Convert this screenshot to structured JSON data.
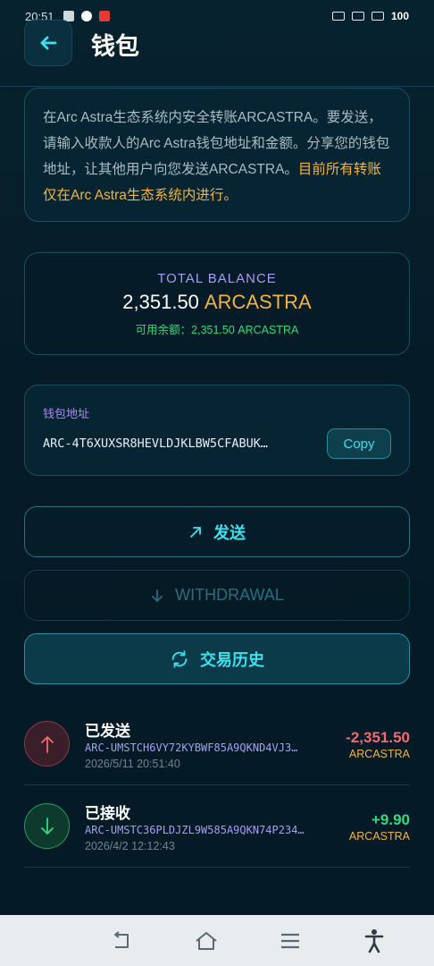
{
  "status_bar": {
    "time": "20:51",
    "battery": "100"
  },
  "header": {
    "title": "钱包"
  },
  "info": {
    "text_normal": "在Arc Astra生态系统内安全转账ARCASTRA。要发送，请输入收款人的Arc Astra钱包地址和金额。分享您的钱包地址，让其他用户向您发送ARCASTRA。",
    "text_highlight": "目前所有转账仅在Arc Astra生态系统内进行。"
  },
  "balance": {
    "label": "TOTAL BALANCE",
    "amount": "2,351.50",
    "unit": "ARCASTRA",
    "available": "可用余额：2,351.50 ARCASTRA"
  },
  "address": {
    "label": "钱包地址",
    "value": "ARC-4T6XUXSR8HEVLDJKLBW5CFABUK…",
    "copy_label": "Copy"
  },
  "actions": {
    "send_label": "发送",
    "withdraw_label": "WITHDRAWAL",
    "history_label": "交易历史"
  },
  "transactions": [
    {
      "type": "已发送",
      "address": "ARC-UMSTCH6VY72KYBWF85A9QKND4VJ3…",
      "date": "2026/5/11 20:51:40",
      "amount": "-2,351.50",
      "unit": "ARCASTRA",
      "direction": "out"
    },
    {
      "type": "已接收",
      "address": "ARC-UMSTC36PLDJZL9W585A9QKN74P234…",
      "date": "2026/4/2 12:12:43",
      "amount": "+9.90",
      "unit": "ARCASTRA",
      "direction": "in"
    }
  ],
  "colors": {
    "accent": "#3fe0ee",
    "gold": "#f4b43a",
    "green": "#35d97e",
    "red": "#f06a6e",
    "purple": "#a89df0"
  },
  "icons": {
    "back": "arrow-left-icon",
    "send": "arrow-up-right-icon",
    "withdraw": "arrow-down-icon",
    "history": "refresh-icon",
    "nav_back": "nav-back-icon",
    "nav_home": "nav-home-icon",
    "nav_menu": "nav-menu-icon",
    "nav_accessibility": "accessibility-icon"
  }
}
